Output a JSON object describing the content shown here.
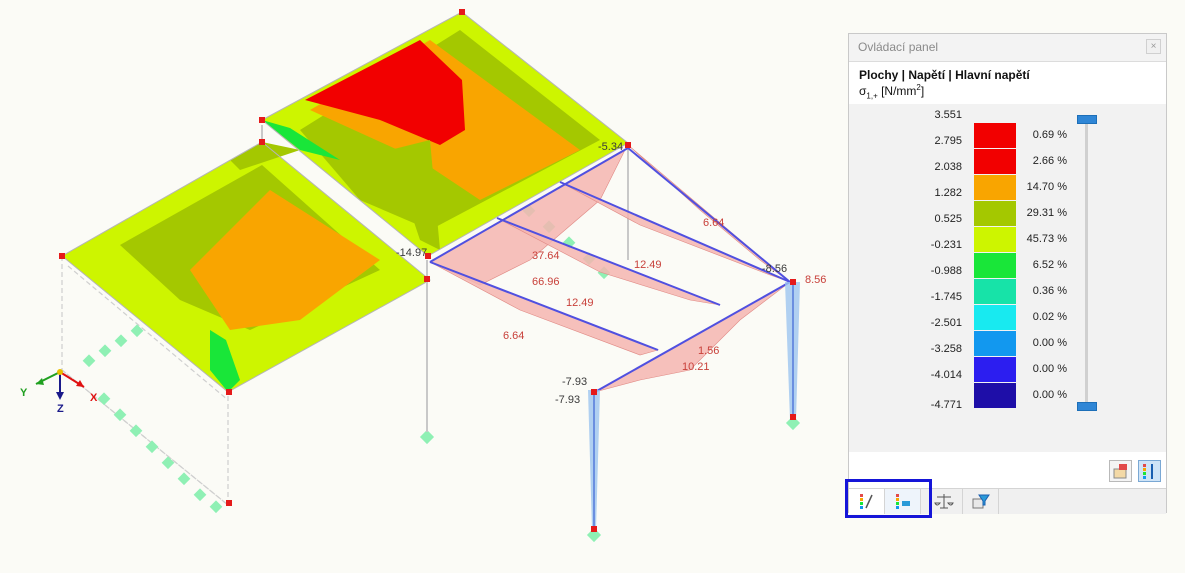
{
  "control_panel": {
    "title": "Ovládací panel",
    "close_label": "×",
    "result_path": "Plochy | Napětí | Hlavní napětí",
    "quantity": "σ",
    "quantity_sub": "1,+",
    "unit": "[N/mm",
    "unit_sup": "2",
    "unit_close": "]",
    "legend": [
      {
        "value": "3.551",
        "percent": "0.69 %",
        "color": "#f20000"
      },
      {
        "value": "2.795",
        "percent": "2.66 %",
        "color": "#f20000"
      },
      {
        "value": "2.038",
        "percent": "14.70 %",
        "color": "#f9a500"
      },
      {
        "value": "1.282",
        "percent": "29.31 %",
        "color": "#a4c800"
      },
      {
        "value": "0.525",
        "percent": "45.73 %",
        "color": "#cdf500"
      },
      {
        "value": "-0.231",
        "percent": "6.52 %",
        "color": "#19e639"
      },
      {
        "value": "-0.988",
        "percent": "0.36 %",
        "color": "#17e3a8"
      },
      {
        "value": "-1.745",
        "percent": "0.02 %",
        "color": "#18eaf0"
      },
      {
        "value": "-2.501",
        "percent": "0.00 %",
        "color": "#1298ef"
      },
      {
        "value": "-3.258",
        "percent": "0.00 %",
        "color": "#2c1ef0"
      },
      {
        "value": "-4.014",
        "percent": "0.00 %",
        "color": "#1e0ea8"
      }
    ],
    "legend_last_value": "-4.771"
  },
  "model_labels": {
    "values": [
      "-5.34",
      "-14.97",
      "6.64",
      "12.49",
      "37.64",
      "66.96",
      "12.49",
      "6.64",
      "-8.56",
      "8.56",
      "1.56",
      "10.21",
      "-7.93",
      "-7.93"
    ]
  },
  "axes": {
    "x": "X",
    "y": "Y",
    "z": "Z"
  },
  "colors": {
    "tab_highlight": "#1515d8",
    "member": "#5050e0",
    "diagram_fill": "#f5b5b0"
  }
}
